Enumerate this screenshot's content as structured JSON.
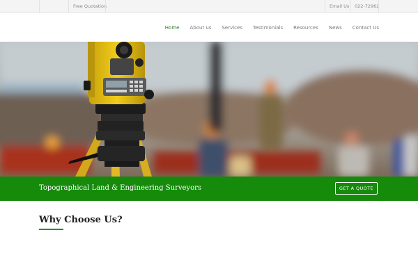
{
  "topbar": {
    "quote_link": "Free Quotation",
    "email_link": "Email Us",
    "phone": "022-72962"
  },
  "nav": {
    "items": [
      {
        "label": "Home",
        "active": true
      },
      {
        "label": "About us"
      },
      {
        "label": "Services"
      },
      {
        "label": "Testimonials"
      },
      {
        "label": "Resources"
      },
      {
        "label": "News"
      },
      {
        "label": "Contact Us"
      }
    ]
  },
  "banner": {
    "tagline": "Topographical Land & Engineering Surveyors",
    "cta_label": "GET A QUOTE"
  },
  "section": {
    "title": "Why Choose Us?"
  },
  "colors": {
    "brand_green": "#158a0b",
    "accent_green": "#2e7d2e"
  }
}
